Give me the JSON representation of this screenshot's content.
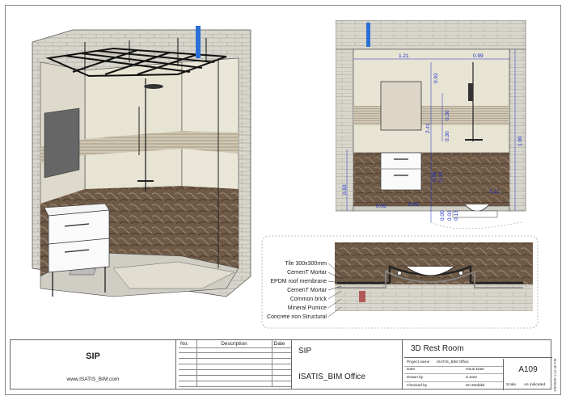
{
  "views": {
    "elevation": {
      "dims": {
        "top_left": "1.21",
        "top_right": "0.99",
        "mirror_h": "0.92",
        "shower_h1": "0.30",
        "shower_h2": "0.30",
        "overall": "2.41",
        "right_h": "1.90",
        "left_h": "0.63",
        "vanity_h1": "0.89",
        "vanity_h2": "0.14",
        "floor_l": "0.05",
        "floor_m": "0.05",
        "floor_r": "0.12",
        "drain1": "0.03",
        "drain2": "0.13",
        "drain3": "0.05"
      }
    },
    "detail": {
      "layers": [
        "Tile 300x300mm",
        "CemenT Mortar",
        "EPDM roof membrane",
        "CemenT Mortar",
        "Common brick",
        "Mineral Pumice",
        "Concrete non Structural"
      ]
    }
  },
  "title_block": {
    "company": "SIP",
    "website": "www.ISATIS_BIM.com",
    "revisions_header": {
      "no": "No.",
      "description": "Description",
      "date": "Date"
    },
    "project_line1": "SIP",
    "project_line2": "ISATIS_BIM Office",
    "sheet_title": "3D Rest Room",
    "meta": {
      "project_name_label": "Project name",
      "project_name": "ISATIS_BIM Office",
      "date_label": "Date",
      "issue_date_label": "Issue Date",
      "drawn_by_label": "Drawn by",
      "drawn_by": "Z.Zare",
      "checked_by_label": "Checked by",
      "checked_by": "SH.Mafakti"
    },
    "sheet_number": "A109",
    "scale_label": "Scale",
    "scale_value": "As indicated",
    "timestamp": "1/6/2025 1:11:45 PM"
  },
  "colors": {
    "wall_tile": "#e7e3d4",
    "marble": "#6b5644",
    "dim_text": "#1a2ec8",
    "frame": "#2a2a2a"
  }
}
